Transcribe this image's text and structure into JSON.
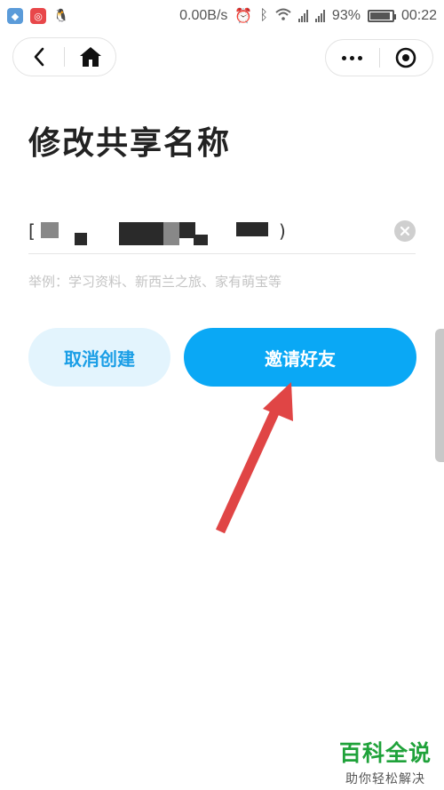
{
  "status_bar": {
    "network_speed": "0.00B/s",
    "battery_percent": "93%",
    "battery_level": 0.93,
    "time": "00:22"
  },
  "nav": {
    "back_icon": "back-chevron-icon",
    "home_icon": "home-icon",
    "more_icon": "more-dots-icon",
    "close_icon": "target-circle-icon"
  },
  "page": {
    "title": "修改共享名称",
    "input_value": "[",
    "input_closing": ")",
    "hint": "举例：学习资料、新西兰之旅、家有萌宝等"
  },
  "buttons": {
    "cancel_label": "取消创建",
    "invite_label": "邀请好友"
  },
  "watermark": {
    "brand": "百科全说",
    "tagline": "助你轻松解决"
  },
  "colors": {
    "accent": "#0aa8f5",
    "cancel_bg": "#e3f4fd",
    "arrow": "#e04545",
    "brand_green": "#1fa23a"
  }
}
